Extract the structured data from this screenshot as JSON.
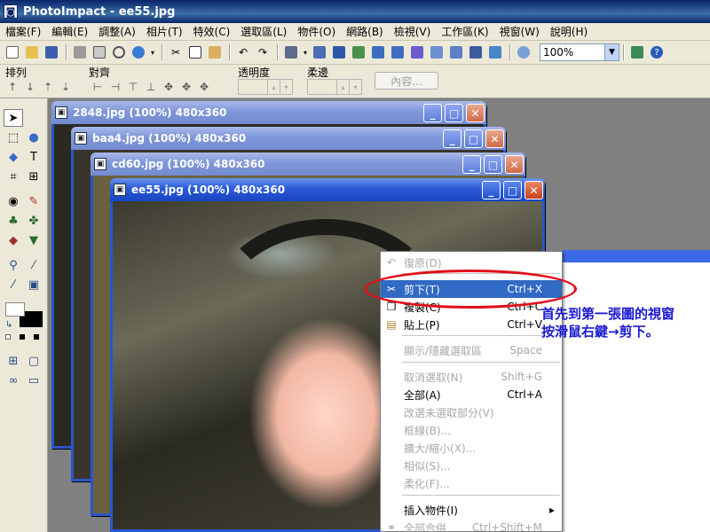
{
  "app": {
    "title": "PhotoImpact - ee55.jpg"
  },
  "menubar": [
    "檔案(F)",
    "編輯(E)",
    "調整(A)",
    "相片(T)",
    "特效(C)",
    "選取區(L)",
    "物件(O)",
    "網路(B)",
    "檢視(V)",
    "工作區(K)",
    "視窗(W)",
    "說明(H)"
  ],
  "toolbar": {
    "zoom_value": "100%"
  },
  "attrbar": {
    "arrange_label": "排列",
    "align_label": "對齊",
    "opacity_label": "透明度",
    "soft_edge_label": "柔邊",
    "content_button": "內容..."
  },
  "windows": [
    {
      "title": "2848.jpg (100%) 480x360",
      "active": false
    },
    {
      "title": "baa4.jpg (100%) 480x360",
      "active": false
    },
    {
      "title": "cd60.jpg (100%) 480x360",
      "active": false
    },
    {
      "title": "ee55.jpg (100%) 480x360",
      "active": true
    }
  ],
  "context_menu": {
    "items": [
      {
        "label": "復原(D)",
        "shortcut": "",
        "disabled": true,
        "icon": "undo-icon"
      },
      {
        "label": "剪下(T)",
        "shortcut": "Ctrl+X",
        "disabled": false,
        "selected": true,
        "icon": "scissors-icon"
      },
      {
        "label": "複製(C)",
        "shortcut": "Ctrl+C",
        "disabled": false,
        "icon": "copy-icon"
      },
      {
        "label": "貼上(P)",
        "shortcut": "Ctrl+V",
        "disabled": false,
        "icon": "paste-icon"
      },
      {
        "label": "顯示/隱藏選取區",
        "shortcut": "Space",
        "disabled": true
      },
      {
        "label": "取消選取(N)",
        "shortcut": "Shift+G",
        "disabled": true
      },
      {
        "label": "全部(A)",
        "shortcut": "Ctrl+A",
        "disabled": false
      },
      {
        "label": "改選未選取部分(V)",
        "shortcut": "",
        "disabled": true
      },
      {
        "label": "框線(B)...",
        "shortcut": "",
        "disabled": true
      },
      {
        "label": "擴大/縮小(X)...",
        "shortcut": "",
        "disabled": true
      },
      {
        "label": "相似(S)...",
        "shortcut": "",
        "disabled": true
      },
      {
        "label": "柔化(F)...",
        "shortcut": "",
        "disabled": true
      },
      {
        "label": "插入物件(I)",
        "shortcut": "",
        "disabled": false,
        "submenu": true
      },
      {
        "label": "全部合併",
        "shortcut": "Ctrl+Shift+M",
        "disabled": true,
        "icon": "merge-icon"
      }
    ]
  },
  "callout": {
    "line1": "首先到第一張圖的視窗",
    "line2": "按滑鼠右鍵→剪下。"
  },
  "colors": {
    "highlight": "#316ac5",
    "callout_red": "#e0101a",
    "callout_blue": "#1a1ad0"
  }
}
